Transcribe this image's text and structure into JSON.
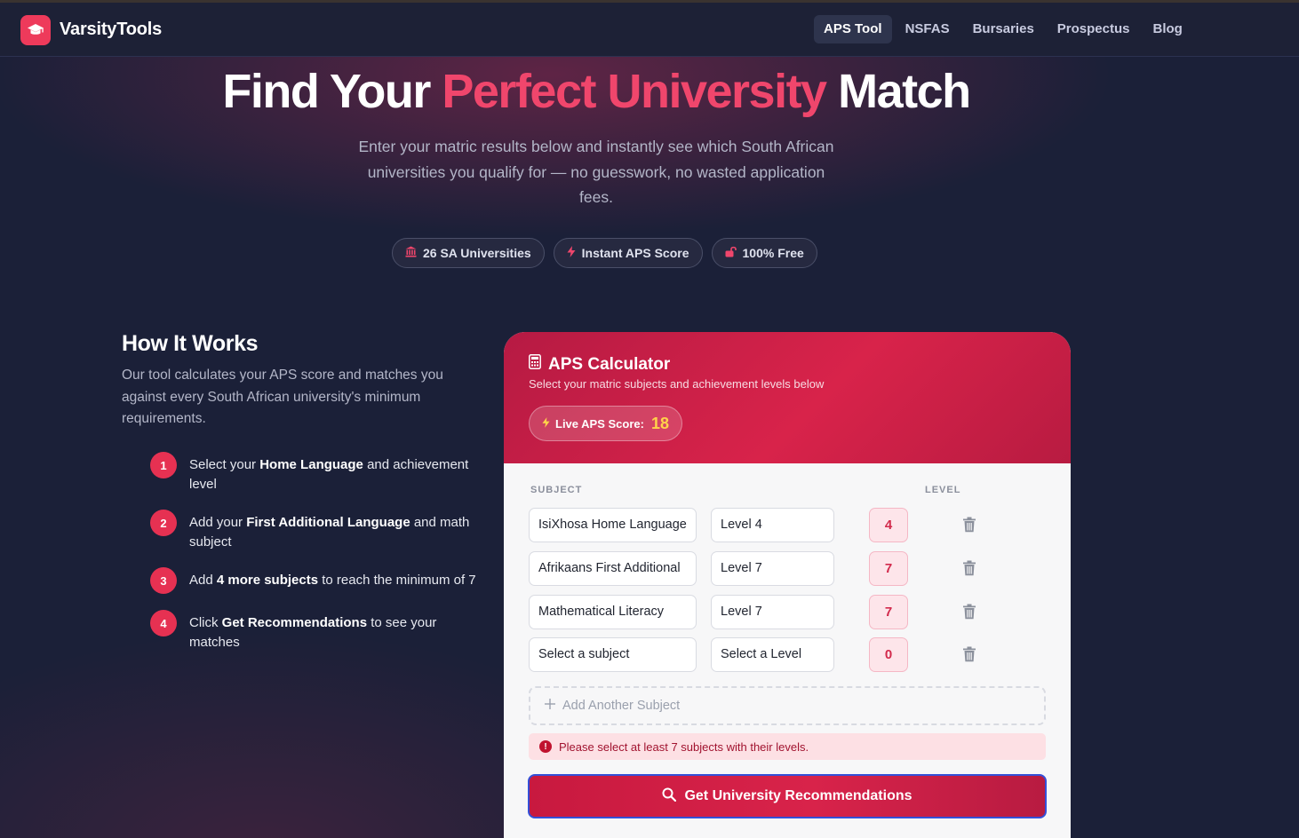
{
  "brand": {
    "name": "VarsityTools",
    "logo_icon": "graduation-cap-icon"
  },
  "nav": {
    "items": [
      {
        "label": "APS Tool",
        "active": true
      },
      {
        "label": "NSFAS",
        "active": false
      },
      {
        "label": "Bursaries",
        "active": false
      },
      {
        "label": "Prospectus",
        "active": false
      },
      {
        "label": "Blog",
        "active": false
      }
    ]
  },
  "hero": {
    "title_part1": "Find Your",
    "title_accent": "Perfect University",
    "title_part2": "Match",
    "subtitle": "Enter your matric results below and instantly see which South African universities you qualify for — no guesswork, no wasted application fees.",
    "chips": [
      {
        "icon": "building-columns-icon",
        "label": "26 SA Universities"
      },
      {
        "icon": "bolt-icon",
        "label": "Instant APS Score"
      },
      {
        "icon": "unlock-icon",
        "label": "100% Free"
      }
    ]
  },
  "how": {
    "title": "How It Works",
    "description": "Our tool calculates your APS score and matches you against every South African university's minimum requirements.",
    "steps": [
      {
        "num": "1",
        "pre": "Select your ",
        "bold": "Home Language",
        "post": " and achievement level"
      },
      {
        "num": "2",
        "pre": "Add your ",
        "bold": "First Additional Language",
        "post": " and math subject"
      },
      {
        "num": "3",
        "pre": "Add ",
        "bold": "4 more subjects",
        "post": " to reach the minimum of 7"
      },
      {
        "num": "4",
        "pre": "Click ",
        "bold": "Get Recommendations",
        "post": " to see your matches"
      }
    ]
  },
  "calculator": {
    "title": "APS Calculator",
    "subtitle": "Select your matric subjects and achievement levels below",
    "live_label": "Live APS Score:",
    "live_score": "18",
    "col_subject": "SUBJECT",
    "col_level": "LEVEL",
    "rows": [
      {
        "subject": "IsiXhosa Home Language",
        "level": "Level 4",
        "points": "4"
      },
      {
        "subject": "Afrikaans First Additional",
        "level": "Level 7",
        "points": "7"
      },
      {
        "subject": "Mathematical Literacy",
        "level": "Level 7",
        "points": "7"
      },
      {
        "subject": "Select a subject",
        "level": "Select a Level",
        "points": "0"
      }
    ],
    "add_label": "Add Another Subject",
    "error": "Please select at least 7 subjects with their levels.",
    "cta_label": "Get University Recommendations"
  },
  "colors": {
    "accent": "#f0466c",
    "primary": "#d8234a",
    "score": "#ffd24a",
    "nav_bg": "#1d2136"
  }
}
